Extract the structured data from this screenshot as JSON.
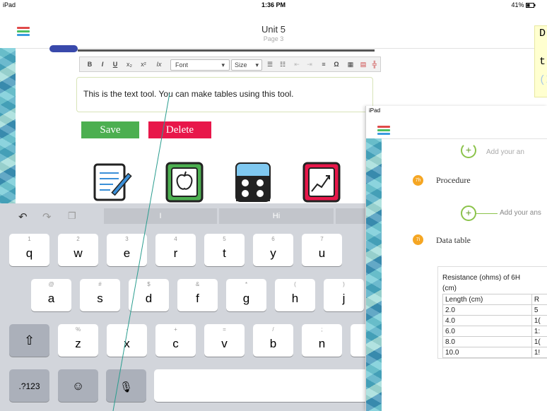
{
  "status": {
    "device": "iPad",
    "time": "1:36 PM",
    "battery": "41%"
  },
  "header": {
    "title": "Unit 5",
    "subtitle": "Page 3",
    "menu_colors": [
      "#e04a4a",
      "#4bc061",
      "#3c9be0"
    ]
  },
  "editor_toolbar": {
    "bold": "B",
    "italic": "I",
    "underline": "U",
    "subscript": "x₂",
    "superscript": "x²",
    "clear_format": "Ix",
    "font": "Font",
    "size": "Size",
    "special_char": "Ω"
  },
  "editor": {
    "text": "This is the text tool. You can make tables using this tool."
  },
  "actions": {
    "save": "Save",
    "delete": "Delete"
  },
  "keyboard": {
    "suggestions": [
      "I",
      "Hi"
    ],
    "row1": [
      {
        "k": "q",
        "s": "1"
      },
      {
        "k": "w",
        "s": "2"
      },
      {
        "k": "e",
        "s": "3"
      },
      {
        "k": "r",
        "s": "4"
      },
      {
        "k": "t",
        "s": "5"
      },
      {
        "k": "y",
        "s": "6"
      },
      {
        "k": "u",
        "s": "7"
      }
    ],
    "row2": [
      {
        "k": "a",
        "s": "@"
      },
      {
        "k": "s",
        "s": "#"
      },
      {
        "k": "d",
        "s": "$"
      },
      {
        "k": "f",
        "s": "&"
      },
      {
        "k": "g",
        "s": "*"
      },
      {
        "k": "h",
        "s": "("
      },
      {
        "k": "j",
        "s": ")"
      }
    ],
    "row3": [
      {
        "k": "z",
        "s": "%"
      },
      {
        "k": "x",
        "s": "-"
      },
      {
        "k": "c",
        "s": "+"
      },
      {
        "k": "v",
        "s": "="
      },
      {
        "k": "b",
        "s": "/"
      },
      {
        "k": "n",
        "s": ";"
      },
      {
        "k": "m",
        "s": ""
      }
    ],
    "numbers_key": ".?123"
  },
  "overlay": {
    "device": "iPad",
    "add_answer_1": "Add your an",
    "add_answer_2": "Add your ans",
    "procedure_badge": "7h",
    "procedure_label": "Procedure",
    "datatable_badge": "7i",
    "datatable_label": "Data table",
    "table_caption": "Resistance (ohms) of 6H",
    "table_caption2": "(cm)",
    "table_headers": [
      "Length (cm)",
      "R"
    ],
    "table_rows": [
      [
        "2.0",
        "5"
      ],
      [
        "4.0",
        "1("
      ],
      [
        "6.0",
        "1:"
      ],
      [
        "8.0",
        "1("
      ],
      [
        "10.0",
        "1!"
      ]
    ]
  },
  "note": {
    "lines": [
      "D",
      "t",
      "(I"
    ]
  }
}
